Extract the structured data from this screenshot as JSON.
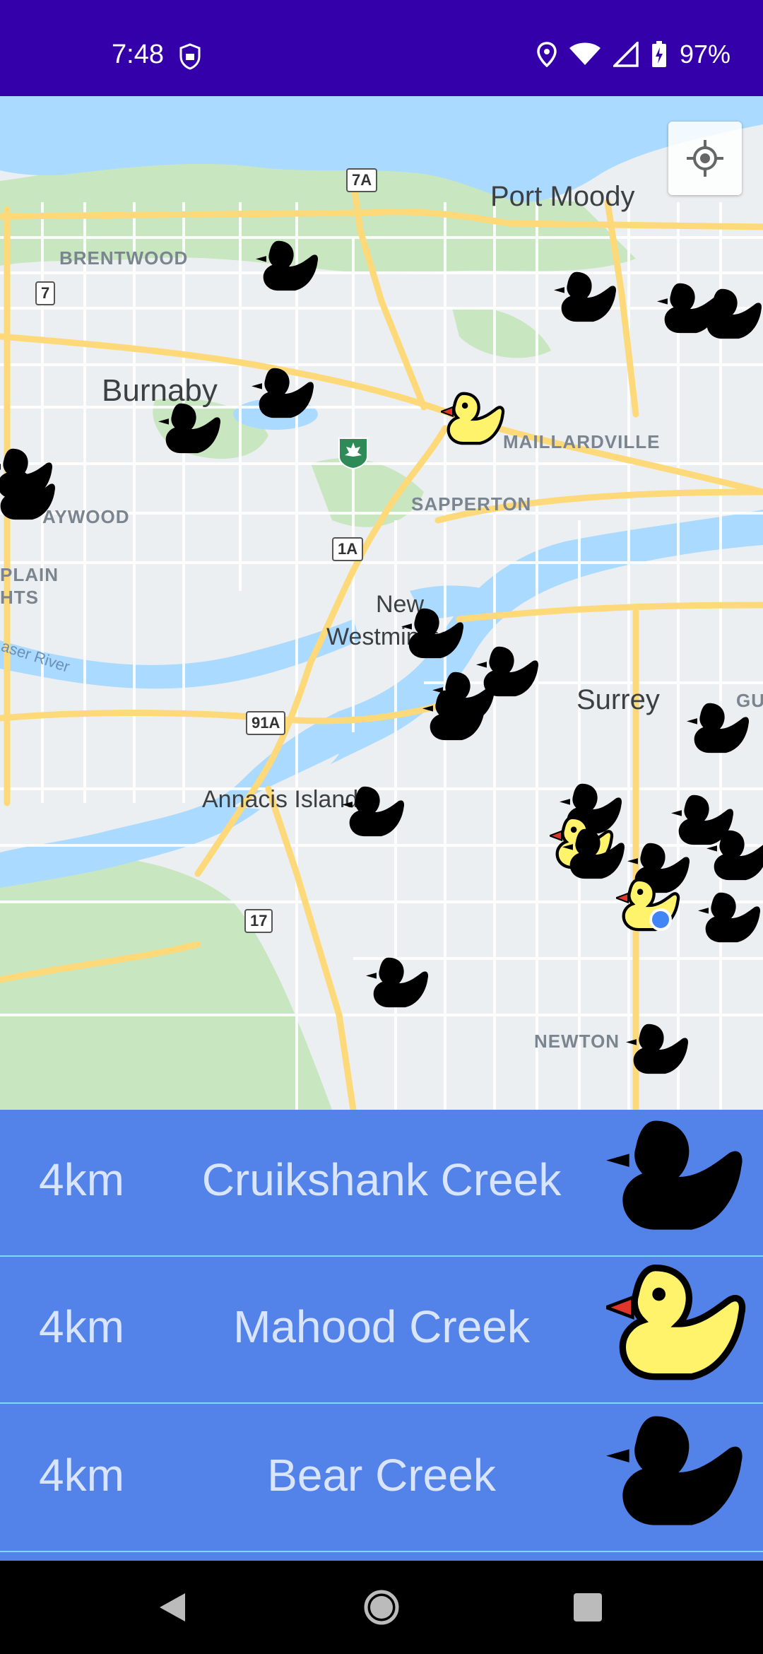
{
  "status_bar": {
    "time": "7:48",
    "battery": "97%",
    "icons": [
      "shield-icon",
      "location-icon",
      "wifi-icon",
      "signal-icon",
      "battery-icon"
    ]
  },
  "map": {
    "labels": {
      "port_moody": "Port Moody",
      "brentwood": "BRENTWOOD",
      "burnaby": "Burnaby",
      "maillardville": "MAILLARDVILLE",
      "sapperton": "SAPPERTON",
      "haywood": "AYWOOD",
      "plain": "PLAIN",
      "hts": "HTS",
      "new_west_1": "New",
      "new_west_2": "Westminster",
      "surrey": "Surrey",
      "gu": "GU",
      "annacis": "Annacis Island",
      "newton": "NEWTON",
      "fraser_river": "aser River"
    },
    "highways": [
      "7A",
      "7",
      "1A",
      "91A",
      "17"
    ],
    "locate_button": "my-location-icon"
  },
  "list": [
    {
      "distance": "4km",
      "name": "Cruikshank Creek",
      "duck": "black"
    },
    {
      "distance": "4km",
      "name": "Mahood Creek",
      "duck": "yellow"
    },
    {
      "distance": "4km",
      "name": "Bear Creek",
      "duck": "black"
    }
  ],
  "colors": {
    "status_bar": "#3300aa",
    "list_bg": "#5383e8",
    "list_text": "#d9e5ff",
    "divider": "#7fd6ff",
    "water": "#aadaff",
    "road": "#fdd97a",
    "duck_yellow": "#fff36b",
    "duck_beak": "#e0352b"
  },
  "nav": [
    "back-icon",
    "home-icon",
    "recents-icon"
  ]
}
